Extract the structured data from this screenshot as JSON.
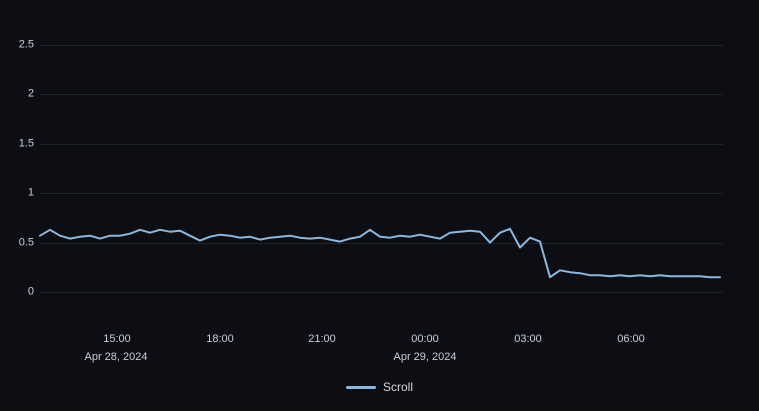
{
  "panel": {
    "background_color": "#0c0e13",
    "grid_color": "rgba(204,210,224,0.11)",
    "text_color": "#ccccdc"
  },
  "chart_data": {
    "type": "line",
    "title": "",
    "xlabel": "",
    "ylabel": "",
    "grid": true,
    "y_axis": {
      "range": [
        0,
        2.95
      ],
      "ticks": [
        {
          "value": 0,
          "label": "0"
        },
        {
          "value": 0.5,
          "label": "0.5"
        },
        {
          "value": 1,
          "label": "1"
        },
        {
          "value": 1.5,
          "label": "1.5"
        },
        {
          "value": 2,
          "label": "2"
        },
        {
          "value": 2.5,
          "label": "2.5"
        }
      ]
    },
    "x_axis": {
      "tick_labels": [
        "15:00",
        "18:00",
        "21:00",
        "00:00",
        "03:00",
        "06:00"
      ],
      "date_labels": [
        "Apr 28, 2024",
        "Apr 29, 2024"
      ],
      "approx_start": "Apr 28, 2024 12:45",
      "approx_end": "Apr 29, 2024 08:40"
    },
    "legend": {
      "position": "bottom-center",
      "entries": [
        {
          "label": "Scroll",
          "color": "#8ab8e0"
        }
      ]
    },
    "series": [
      {
        "name": "Scroll",
        "color": "#8ab8e0",
        "sample_interval_minutes": 17.5,
        "start_time": "Apr 28, 2024 12:45",
        "values": [
          0.57,
          0.63,
          0.57,
          0.54,
          0.56,
          0.57,
          0.54,
          0.57,
          0.57,
          0.59,
          0.63,
          0.6,
          0.63,
          0.61,
          0.62,
          0.57,
          0.52,
          0.56,
          0.58,
          0.57,
          0.55,
          0.56,
          0.53,
          0.55,
          0.56,
          0.57,
          0.55,
          0.54,
          0.55,
          0.53,
          0.51,
          0.54,
          0.56,
          0.63,
          0.56,
          0.55,
          0.57,
          0.56,
          0.58,
          0.56,
          0.54,
          0.6,
          0.61,
          0.62,
          0.61,
          0.5,
          0.6,
          0.64,
          0.45,
          0.55,
          0.51,
          0.15,
          0.22,
          0.2,
          0.19,
          0.17,
          0.17,
          0.16,
          0.17,
          0.16,
          0.17,
          0.16,
          0.17,
          0.16,
          0.16,
          0.16,
          0.16,
          0.15,
          0.15
        ]
      }
    ]
  }
}
